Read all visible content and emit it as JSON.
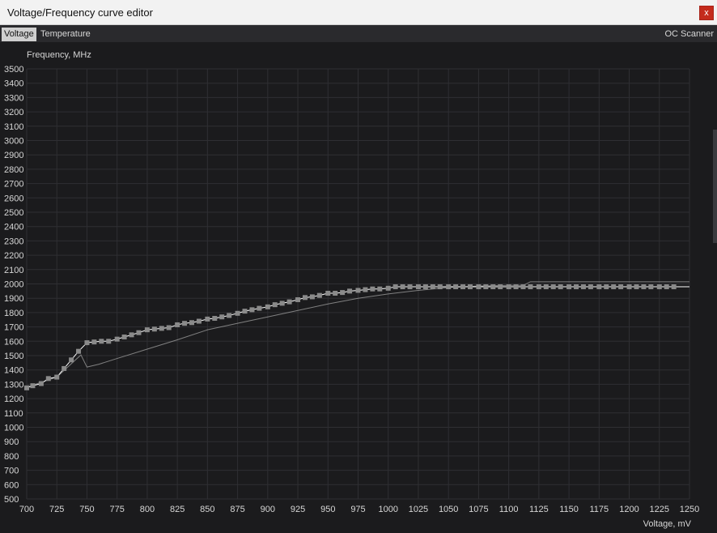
{
  "window": {
    "title": "Voltage/Frequency curve editor",
    "close_label": "x"
  },
  "tabs": [
    {
      "label": "Voltage",
      "active": true
    },
    {
      "label": "Temperature",
      "active": false
    }
  ],
  "oc_scanner_label": "OC Scanner",
  "colors": {
    "background": "#1b1b1d",
    "grid": "#2f2f33",
    "curve": "#ffffff",
    "points": "#8a8a8a",
    "ref_curve": "#9a9a9a"
  },
  "chart_data": {
    "type": "line",
    "ylabel": "Frequency, MHz",
    "xlabel": "Voltage, mV",
    "xlim": [
      700,
      1250
    ],
    "ylim": [
      500,
      3500
    ],
    "x_ticks": [
      700,
      725,
      750,
      775,
      800,
      825,
      850,
      875,
      900,
      925,
      950,
      975,
      1000,
      1025,
      1050,
      1075,
      1100,
      1125,
      1150,
      1175,
      1200,
      1225,
      1250
    ],
    "y_ticks": [
      500,
      600,
      700,
      800,
      900,
      1000,
      1100,
      1200,
      1300,
      1400,
      1500,
      1600,
      1700,
      1800,
      1900,
      2000,
      2100,
      2200,
      2300,
      2400,
      2500,
      2600,
      2700,
      2800,
      2900,
      3000,
      3100,
      3200,
      3300,
      3400,
      3500
    ],
    "grid": true,
    "series": [
      {
        "role": "curve-points",
        "points": [
          [
            700,
            1275
          ],
          [
            705,
            1290
          ],
          [
            712,
            1305
          ],
          [
            718,
            1340
          ],
          [
            725,
            1350
          ],
          [
            731,
            1410
          ],
          [
            737,
            1470
          ],
          [
            743,
            1530
          ],
          [
            750,
            1590
          ],
          [
            756,
            1595
          ],
          [
            762,
            1600
          ],
          [
            768,
            1600
          ],
          [
            775,
            1615
          ],
          [
            781,
            1630
          ],
          [
            787,
            1645
          ],
          [
            793,
            1660
          ],
          [
            800,
            1680
          ],
          [
            806,
            1685
          ],
          [
            812,
            1690
          ],
          [
            818,
            1695
          ],
          [
            825,
            1715
          ],
          [
            831,
            1725
          ],
          [
            837,
            1730
          ],
          [
            843,
            1740
          ],
          [
            850,
            1755
          ],
          [
            856,
            1760
          ],
          [
            862,
            1770
          ],
          [
            868,
            1780
          ],
          [
            875,
            1795
          ],
          [
            881,
            1810
          ],
          [
            887,
            1820
          ],
          [
            893,
            1830
          ],
          [
            900,
            1840
          ],
          [
            906,
            1855
          ],
          [
            912,
            1865
          ],
          [
            918,
            1875
          ],
          [
            925,
            1890
          ],
          [
            931,
            1905
          ],
          [
            937,
            1910
          ],
          [
            943,
            1920
          ],
          [
            950,
            1935
          ],
          [
            956,
            1935
          ],
          [
            962,
            1940
          ],
          [
            968,
            1950
          ],
          [
            975,
            1955
          ],
          [
            981,
            1960
          ],
          [
            987,
            1965
          ],
          [
            993,
            1965
          ],
          [
            1000,
            1970
          ],
          [
            1006,
            1980
          ],
          [
            1012,
            1980
          ],
          [
            1018,
            1980
          ],
          [
            1025,
            1980
          ],
          [
            1031,
            1980
          ],
          [
            1037,
            1980
          ],
          [
            1043,
            1980
          ],
          [
            1050,
            1980
          ],
          [
            1056,
            1980
          ],
          [
            1062,
            1980
          ],
          [
            1068,
            1980
          ],
          [
            1075,
            1980
          ],
          [
            1081,
            1980
          ],
          [
            1087,
            1980
          ],
          [
            1093,
            1980
          ],
          [
            1100,
            1980
          ],
          [
            1106,
            1980
          ],
          [
            1112,
            1980
          ],
          [
            1118,
            1980
          ],
          [
            1125,
            1980
          ],
          [
            1131,
            1980
          ],
          [
            1137,
            1980
          ],
          [
            1143,
            1980
          ],
          [
            1150,
            1980
          ],
          [
            1156,
            1980
          ],
          [
            1162,
            1980
          ],
          [
            1168,
            1980
          ],
          [
            1175,
            1980
          ],
          [
            1181,
            1980
          ],
          [
            1187,
            1980
          ],
          [
            1193,
            1980
          ],
          [
            1200,
            1980
          ],
          [
            1206,
            1980
          ],
          [
            1212,
            1980
          ],
          [
            1218,
            1980
          ],
          [
            1225,
            1980
          ],
          [
            1231,
            1980
          ],
          [
            1237,
            1980
          ]
        ],
        "line_extends_to": [
          1250,
          1980
        ]
      },
      {
        "role": "reference-curve",
        "points": [
          [
            700,
            1280
          ],
          [
            725,
            1350
          ],
          [
            745,
            1505
          ],
          [
            750,
            1420
          ],
          [
            760,
            1440
          ],
          [
            775,
            1480
          ],
          [
            800,
            1545
          ],
          [
            825,
            1610
          ],
          [
            850,
            1680
          ],
          [
            875,
            1725
          ],
          [
            900,
            1770
          ],
          [
            925,
            1815
          ],
          [
            950,
            1860
          ],
          [
            975,
            1900
          ],
          [
            1000,
            1930
          ],
          [
            1025,
            1955
          ],
          [
            1050,
            1975
          ],
          [
            1075,
            1985
          ],
          [
            1100,
            1990
          ],
          [
            1112,
            1990
          ],
          [
            1118,
            2015
          ],
          [
            1150,
            2015
          ],
          [
            1200,
            2015
          ],
          [
            1250,
            2015
          ]
        ]
      }
    ]
  }
}
